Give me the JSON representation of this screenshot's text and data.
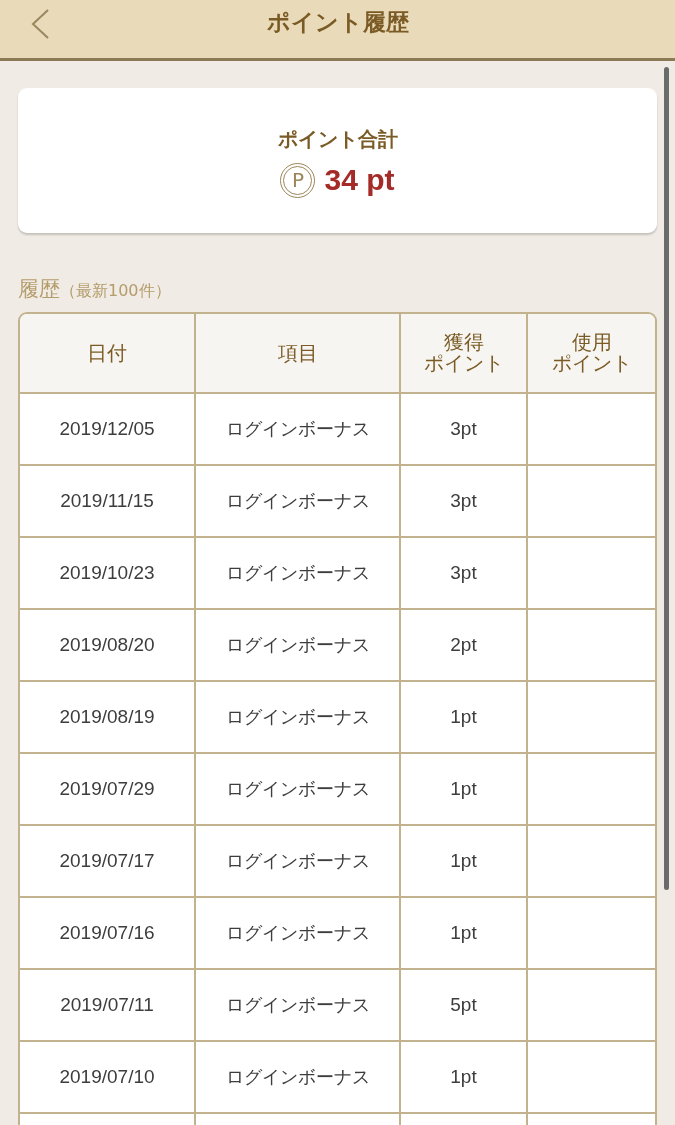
{
  "header": {
    "title": "ポイント履歴"
  },
  "summary": {
    "label": "ポイント合計",
    "coin_symbol": "P",
    "total": "34 pt"
  },
  "history": {
    "title": "履歴",
    "note": "（最新100件）",
    "columns": [
      [
        "日付"
      ],
      [
        "項目"
      ],
      [
        "獲得",
        "ポイント"
      ],
      [
        "使用",
        "ポイント"
      ]
    ],
    "rows": [
      {
        "date": "2019/12/05",
        "item": "ログインボーナス",
        "earned": "3pt"
      },
      {
        "date": "2019/11/15",
        "item": "ログインボーナス",
        "earned": "3pt"
      },
      {
        "date": "2019/10/23",
        "item": "ログインボーナス",
        "earned": "3pt"
      },
      {
        "date": "2019/08/20",
        "item": "ログインボーナス",
        "earned": "2pt"
      },
      {
        "date": "2019/08/19",
        "item": "ログインボーナス",
        "earned": "1pt"
      },
      {
        "date": "2019/07/29",
        "item": "ログインボーナス",
        "earned": "1pt"
      },
      {
        "date": "2019/07/17",
        "item": "ログインボーナス",
        "earned": "1pt"
      },
      {
        "date": "2019/07/16",
        "item": "ログインボーナス",
        "earned": "1pt"
      },
      {
        "date": "2019/07/11",
        "item": "ログインボーナス",
        "earned": "5pt"
      },
      {
        "date": "2019/07/10",
        "item": "ログインボーナス",
        "earned": "1pt"
      }
    ]
  }
}
